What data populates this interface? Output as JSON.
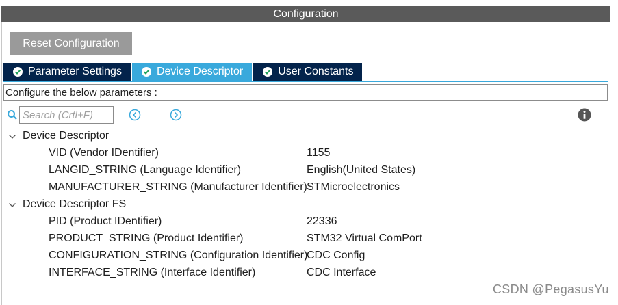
{
  "window": {
    "title": "Configuration"
  },
  "toolbar": {
    "reset_label": "Reset Configuration"
  },
  "tabs": [
    {
      "label": "Parameter Settings",
      "active": false,
      "icon": "check-circle-icon"
    },
    {
      "label": "Device Descriptor",
      "active": true,
      "icon": "check-circle-icon"
    },
    {
      "label": "User Constants",
      "active": false,
      "icon": "check-circle-icon"
    }
  ],
  "panel": {
    "description": "Configure the below parameters :"
  },
  "search": {
    "placeholder": "Search (Crtl+F)",
    "value": ""
  },
  "groups": [
    {
      "label": "Device Descriptor",
      "expanded": true,
      "params": [
        {
          "name": "VID (Vendor IDentifier)",
          "value": "1155"
        },
        {
          "name": "LANGID_STRING (Language Identifier)",
          "value": "English(United States)"
        },
        {
          "name": "MANUFACTURER_STRING (Manufacturer Identifier)",
          "value": "STMicroelectronics"
        }
      ]
    },
    {
      "label": "Device Descriptor FS",
      "expanded": true,
      "params": [
        {
          "name": "PID (Product IDentifier)",
          "value": "22336"
        },
        {
          "name": "PRODUCT_STRING (Product Identifier)",
          "value": "STM32 Virtual ComPort"
        },
        {
          "name": "CONFIGURATION_STRING (Configuration Identifier)",
          "value": "CDC Config"
        },
        {
          "name": "INTERFACE_STRING (Interface Identifier)",
          "value": "CDC Interface"
        }
      ]
    }
  ],
  "watermark": "CSDN @PegasusYu",
  "colors": {
    "title_bar": "#5a5a5a",
    "tab_inactive": "#03234b",
    "tab_active": "#39a9dc",
    "reset_button": "#9a9a9a",
    "nav_icon": "#39a9dc"
  }
}
